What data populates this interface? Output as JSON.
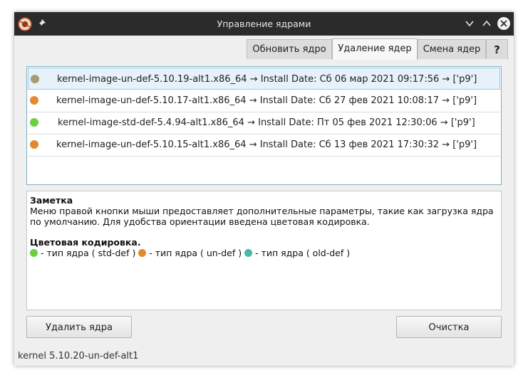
{
  "window": {
    "title": "Управление ядрами"
  },
  "tabs": [
    {
      "label": "Обновить ядро",
      "active": false
    },
    {
      "label": "Удаление ядер",
      "active": true
    },
    {
      "label": "Смена ядер",
      "active": false
    },
    {
      "label": "?",
      "active": false
    }
  ],
  "kernels": [
    {
      "name": "kernel-image-un-def-5.10.19-alt1.x86_64",
      "date": "Сб 06 мар 2021 09:17:56",
      "repo": "['p9']",
      "color": "#a89a74",
      "selected": true
    },
    {
      "name": "kernel-image-un-def-5.10.17-alt1.x86_64",
      "date": "Сб 27 фев 2021 10:08:17",
      "repo": "['p9']",
      "color": "#e38a2e",
      "selected": false
    },
    {
      "name": "kernel-image-std-def-5.4.94-alt1.x86_64",
      "date": "Пт 05 фев 2021 12:30:06",
      "repo": "['p9']",
      "color": "#6ccf3c",
      "selected": false
    },
    {
      "name": "kernel-image-un-def-5.10.15-alt1.x86_64",
      "date": "Сб 13 фев 2021 17:30:32",
      "repo": "['p9']",
      "color": "#e38a2e",
      "selected": false
    }
  ],
  "row_labels": {
    "install_date": "Install Date:",
    "arrow": "→"
  },
  "note": {
    "heading": "Заметка",
    "text": "Меню правой кнопки мыши предоставляет дополнительные параметры, такие как загрузка ядра по умолчанию. Для удобства ориентации введена цветовая кодировка.",
    "color_heading": "Цветовая кодировка.",
    "legend": [
      {
        "color": "#6ccf3c",
        "text": " - тип ядра ( std-def ) "
      },
      {
        "color": "#e38a2e",
        "text": " - тип ядра ( un-def ) "
      },
      {
        "color": "#46b8a8",
        "text": " - тип ядра ( old-def )"
      }
    ]
  },
  "buttons": {
    "remove": "Удалить ядра",
    "clean": "Очистка"
  },
  "status": "kernel 5.10.20-un-def-alt1"
}
